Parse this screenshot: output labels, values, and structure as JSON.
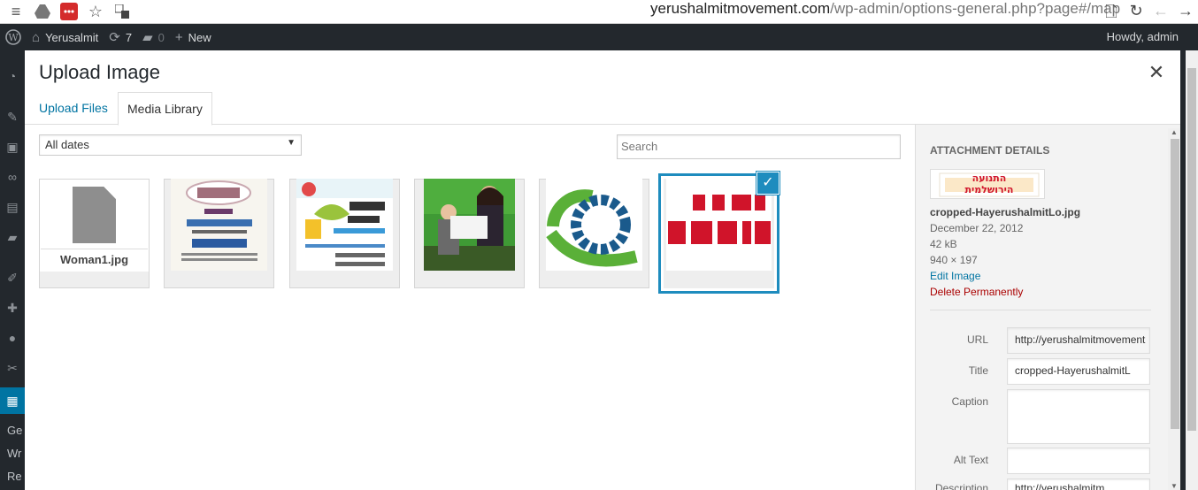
{
  "browser": {
    "url_host": "yerushalmitmovement.com",
    "url_path": "/wp-admin/options-general.php?page#/map"
  },
  "adminbar": {
    "site_name": "Yerusalmit",
    "updates_count": "7",
    "comments_count": "0",
    "new_label": "New",
    "howdy": "Howdy, admin"
  },
  "sidemenu": {
    "items": [
      "Ge",
      "Wr",
      "Re"
    ]
  },
  "modal": {
    "title": "Upload Image",
    "tabs": [
      "Upload Files",
      "Media Library"
    ],
    "active_tab": "Media Library",
    "filter_value": "All dates",
    "search_placeholder": "Search",
    "attachments": [
      {
        "type": "file",
        "filename": "Woman1.jpg"
      },
      {
        "type": "image",
        "desc": "Shabbat event poster 16.2.13"
      },
      {
        "type": "image",
        "desc": "Children event poster"
      },
      {
        "type": "image",
        "desc": "Woman and child photo"
      },
      {
        "type": "image",
        "desc": "Green and blue logo"
      },
      {
        "type": "image",
        "desc": "Red Hebrew logo",
        "selected": true
      }
    ]
  },
  "details": {
    "heading": "ATTACHMENT DETAILS",
    "filename": "cropped-HayerushalmitLo.jpg",
    "date": "December 22, 2012",
    "size": "42 kB",
    "dimensions": "940 × 197",
    "edit_link": "Edit Image",
    "delete_link": "Delete Permanently",
    "thumb_text_line1": "התנועה",
    "thumb_text_line2": "הירושלמית",
    "fields": {
      "url_label": "URL",
      "url_value": "http://yerushalmitmovement",
      "title_label": "Title",
      "title_value": "cropped-HayerushalmitL",
      "caption_label": "Caption",
      "caption_value": "",
      "alt_label": "Alt Text",
      "alt_value": "",
      "description_label": "Description",
      "description_value": "http://yerushalmitm"
    }
  },
  "colors": {
    "accent": "#0074a2",
    "selected_border": "#1e8cbe",
    "admin_bg": "#23282d",
    "danger": "#a00000"
  }
}
